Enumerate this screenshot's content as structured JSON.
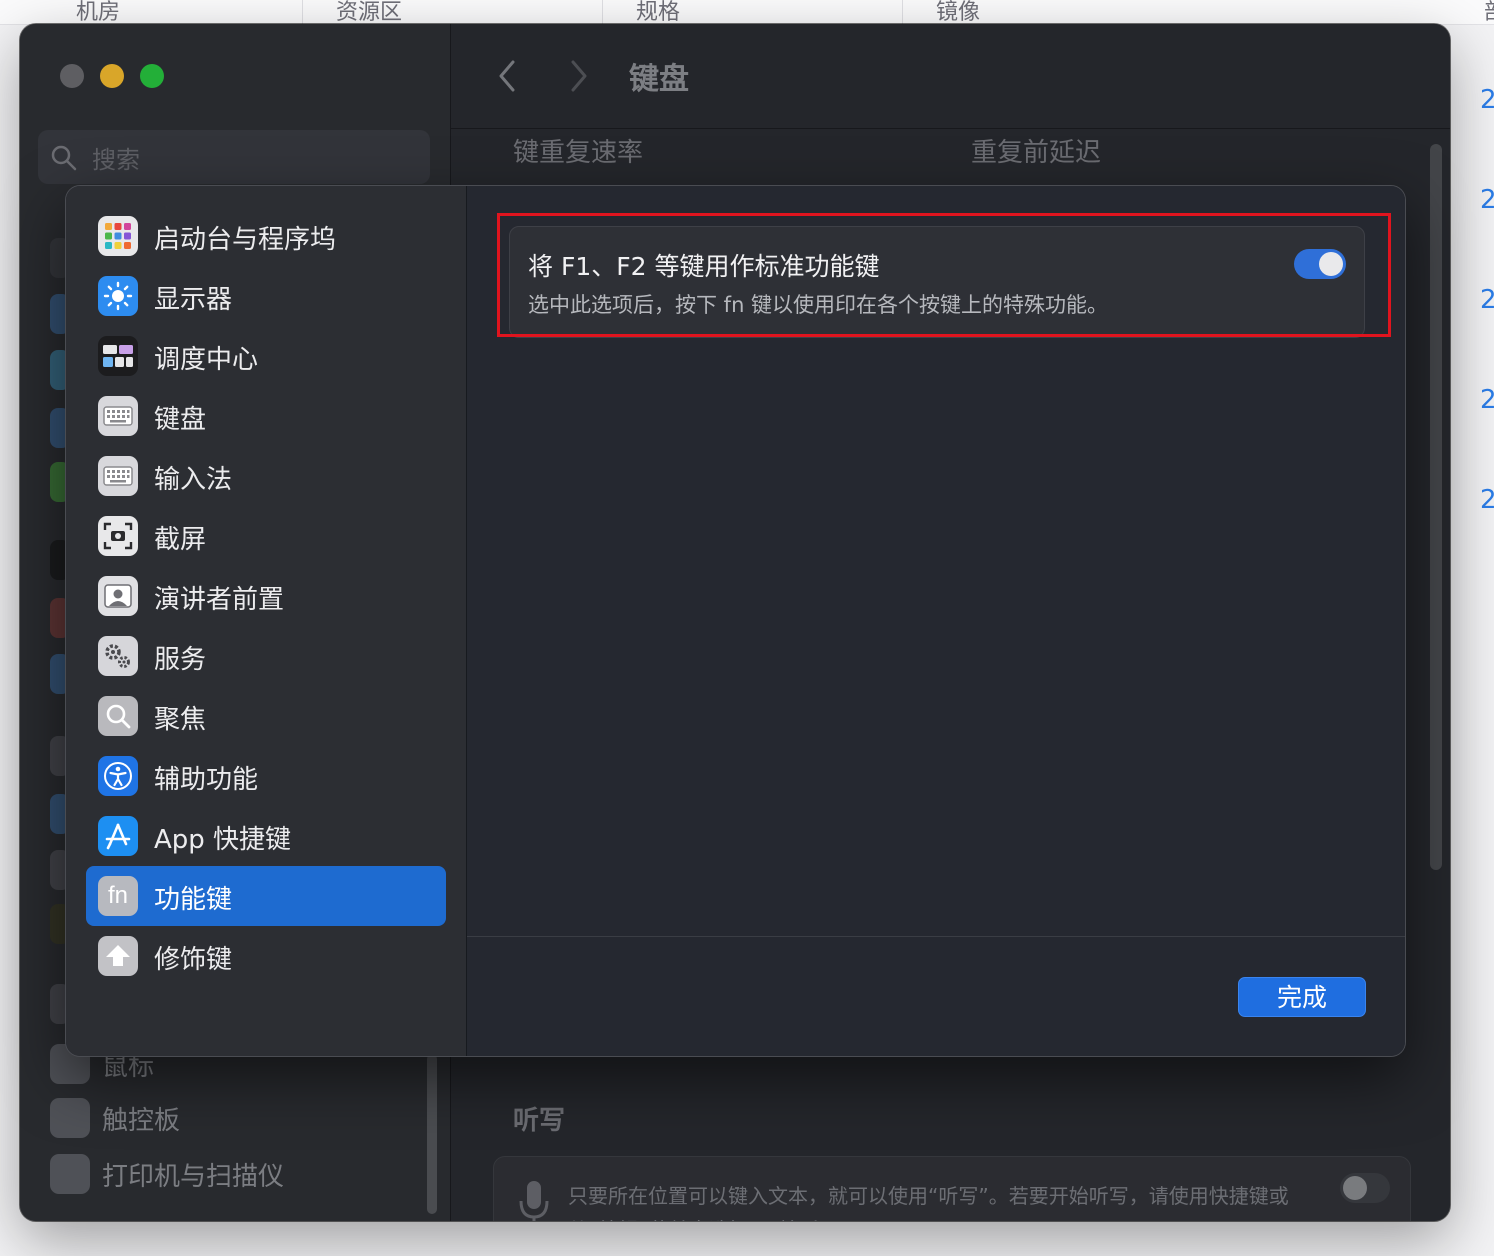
{
  "background_page": {
    "columns": [
      "机房",
      "资源区",
      "规格",
      "镜像",
      "部"
    ],
    "right_marks": [
      "2",
      "2",
      "2",
      "2",
      "2"
    ]
  },
  "window": {
    "title": "键盘",
    "search_placeholder": "搜索",
    "background_labels": {
      "key_repeat_rate": "键重复速率",
      "delay_until_repeat": "重复前延迟",
      "dictation_section": "听写",
      "dictation_desc": "只要所在位置可以键入文本，就可以使用“听写”。若要开始听写，请使用快捷键或从“编辑”菜单中选择“开始听写”。"
    },
    "background_sidebar": [
      {
        "label": "鼠标"
      },
      {
        "label": "触控板"
      },
      {
        "label": "打印机与扫描仪"
      }
    ]
  },
  "sheet": {
    "sidebar": [
      {
        "label": "启动台与程序坞",
        "icon": "launchpad-icon",
        "selected": false
      },
      {
        "label": "显示器",
        "icon": "display-brightness-icon",
        "selected": false
      },
      {
        "label": "调度中心",
        "icon": "mission-control-icon",
        "selected": false
      },
      {
        "label": "键盘",
        "icon": "keyboard-icon",
        "selected": false
      },
      {
        "label": "输入法",
        "icon": "input-method-icon",
        "selected": false
      },
      {
        "label": "截屏",
        "icon": "screenshot-icon",
        "selected": false
      },
      {
        "label": "演讲者前置",
        "icon": "presenter-overlay-icon",
        "selected": false
      },
      {
        "label": "服务",
        "icon": "services-gears-icon",
        "selected": false
      },
      {
        "label": "聚焦",
        "icon": "spotlight-icon",
        "selected": false
      },
      {
        "label": "辅助功能",
        "icon": "accessibility-icon",
        "selected": false
      },
      {
        "label": "App 快捷键",
        "icon": "app-store-icon",
        "selected": false
      },
      {
        "label": "功能键",
        "icon": "fn-key-icon",
        "selected": true
      },
      {
        "label": "修饰键",
        "icon": "modifier-keys-icon",
        "selected": false
      }
    ],
    "option": {
      "title": "将 F1、F2 等键用作标准功能键",
      "description": "选中此选项后，按下 fn 键以使用印在各个按键上的特殊功能。",
      "enabled": true
    },
    "done_label": "完成",
    "fn_icon_text": "fn"
  },
  "colors": {
    "accent": "#1e6bd0",
    "highlight_frame": "#e0141e",
    "window_bg": "#2a2c31"
  }
}
